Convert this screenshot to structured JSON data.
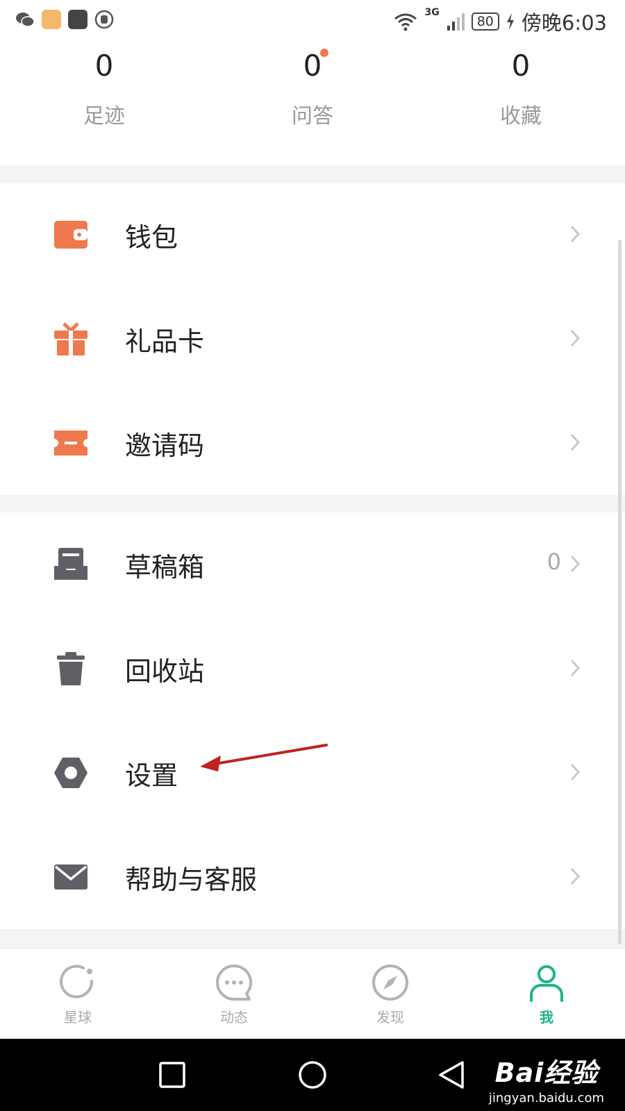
{
  "statusbar": {
    "network": "3G",
    "battery": "80",
    "time": "傍晚6:03"
  },
  "stats": [
    {
      "value": "0",
      "label": "足迹"
    },
    {
      "value": "0",
      "label": "问答"
    },
    {
      "value": "0",
      "label": "收藏"
    }
  ],
  "menu_group1": [
    {
      "label": "钱包",
      "icon": "wallet-icon"
    },
    {
      "label": "礼品卡",
      "icon": "gift-icon"
    },
    {
      "label": "邀请码",
      "icon": "ticket-icon"
    }
  ],
  "menu_group2": [
    {
      "label": "草稿箱",
      "icon": "drafts-icon",
      "count": "0"
    },
    {
      "label": "回收站",
      "icon": "trash-icon"
    },
    {
      "label": "设置",
      "icon": "settings-icon"
    },
    {
      "label": "帮助与客服",
      "icon": "mail-icon"
    }
  ],
  "tabs": [
    {
      "label": "星球",
      "icon": "planet-icon",
      "active": false
    },
    {
      "label": "动态",
      "icon": "chat-icon",
      "active": false
    },
    {
      "label": "发现",
      "icon": "compass-icon",
      "active": false
    },
    {
      "label": "我",
      "icon": "person-icon",
      "active": true
    }
  ],
  "watermark": {
    "main": "Bai经验",
    "sub": "jingyan.baidu.com"
  },
  "colors": {
    "accent_orange": "#F0784E",
    "icon_gray": "#5f5f66",
    "active_green": "#1DB28A",
    "annotation_red": "#C0221E"
  }
}
